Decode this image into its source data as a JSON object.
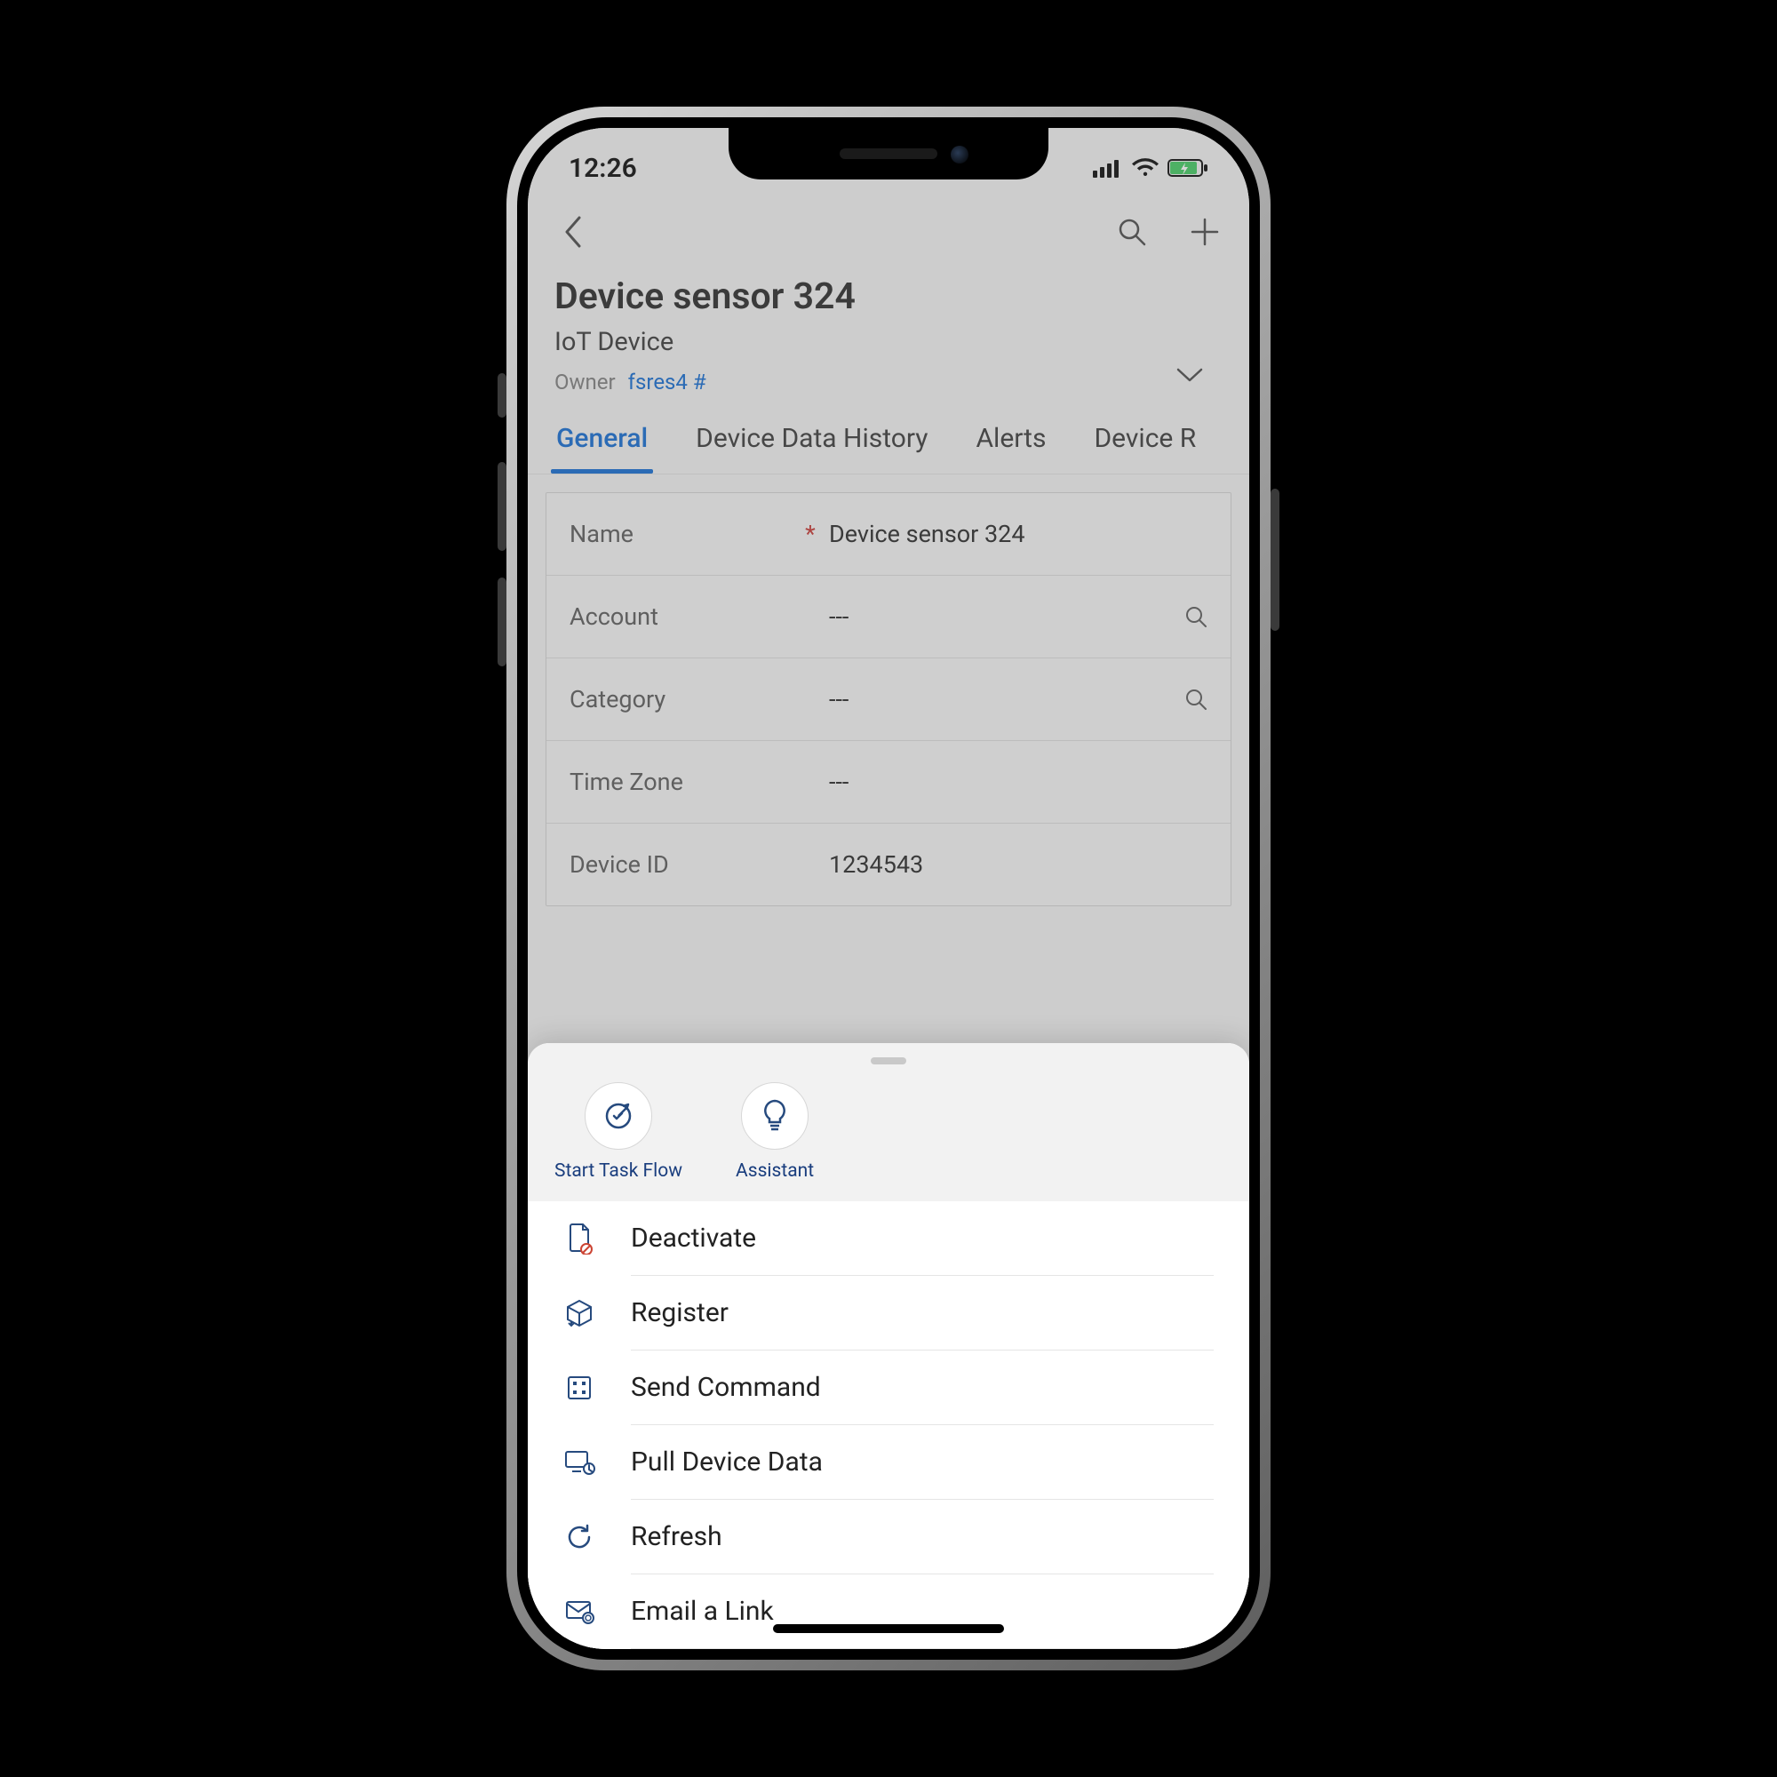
{
  "status_bar": {
    "time": "12:26"
  },
  "header": {
    "title": "Device sensor 324",
    "subtitle": "IoT Device",
    "owner_label": "Owner",
    "owner_value": "fsres4 #"
  },
  "tabs": [
    {
      "label": "General",
      "active": true
    },
    {
      "label": "Device Data History",
      "active": false
    },
    {
      "label": "Alerts",
      "active": false
    },
    {
      "label": "Device R",
      "active": false
    }
  ],
  "form": {
    "empty": "---",
    "rows": [
      {
        "label": "Name",
        "value": "Device sensor 324",
        "required": true,
        "search": false
      },
      {
        "label": "Account",
        "value": "---",
        "required": false,
        "search": true
      },
      {
        "label": "Category",
        "value": "---",
        "required": false,
        "search": true
      },
      {
        "label": "Time Zone",
        "value": "---",
        "required": false,
        "search": false
      },
      {
        "label": "Device ID",
        "value": "1234543",
        "required": false,
        "search": false
      }
    ]
  },
  "sheet": {
    "quick_actions": [
      {
        "label": "Start Task Flow",
        "icon": "task-flow"
      },
      {
        "label": "Assistant",
        "icon": "lightbulb"
      }
    ],
    "menu": [
      {
        "label": "Deactivate",
        "icon": "deactivate"
      },
      {
        "label": "Register",
        "icon": "package"
      },
      {
        "label": "Send Command",
        "icon": "command"
      },
      {
        "label": "Pull Device Data",
        "icon": "pull-data"
      },
      {
        "label": "Refresh",
        "icon": "refresh"
      },
      {
        "label": "Email a Link",
        "icon": "email-link"
      }
    ]
  }
}
